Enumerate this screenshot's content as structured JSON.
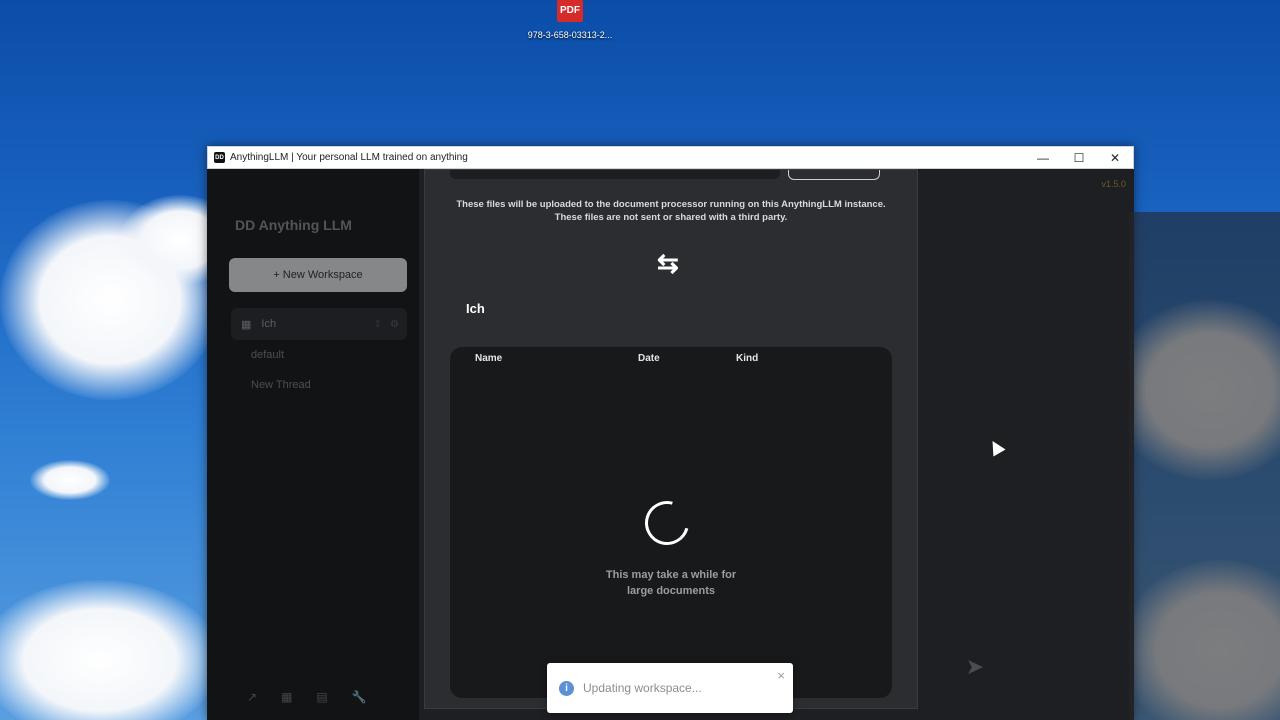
{
  "desktop": {
    "icon_badge": "PDF",
    "icon_label": "978-3-658-03313-2..."
  },
  "window": {
    "app_icon_text": "DD",
    "title": "AnythingLLM | Your personal LLM trained on anything",
    "minimize": "—",
    "maximize": "☐",
    "close": "✕"
  },
  "sidebar": {
    "logo": "DD Anything LLM",
    "new_workspace": "+ New Workspace",
    "workspace_name": "Ich",
    "threads": [
      "default",
      "New Thread"
    ],
    "footer_icons": [
      "↗",
      "▦",
      "▤",
      "🔧"
    ]
  },
  "topbar": {
    "version": "v1.5.0"
  },
  "modal": {
    "info_line1": "These files will be uploaded to the document processor running on this AnythingLLM instance.",
    "info_line2": "These files are not sent or shared with a third party.",
    "swap_icon": "⇆",
    "workspace_title": "Ich",
    "columns": {
      "name": "Name",
      "date": "Date",
      "kind": "Kind"
    },
    "wait_line1": "This may take a while for",
    "wait_line2": "large documents"
  },
  "toast": {
    "icon": "i",
    "message": "Updating workspace...",
    "close": "×"
  },
  "colors": {
    "accent": "#5b8fd6",
    "modal_bg": "#2b2d31",
    "panel_bg": "#18191b"
  }
}
